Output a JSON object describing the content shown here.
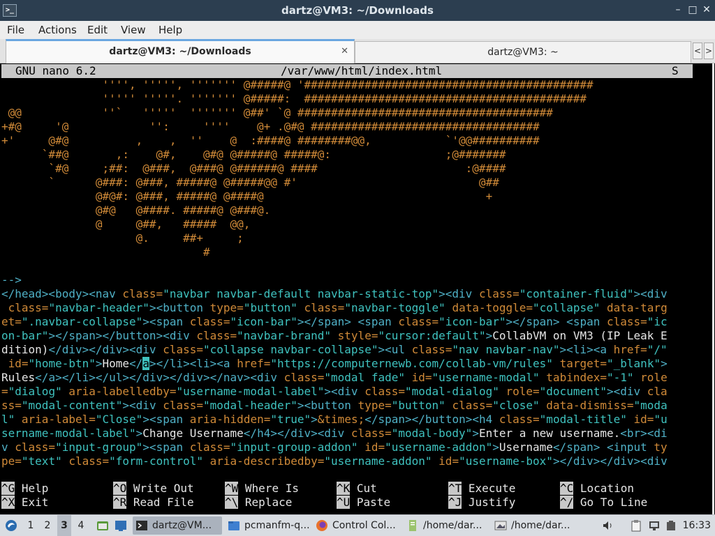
{
  "window": {
    "title": "dartz@VM3: ~/Downloads",
    "app_icon_glyph": ">_",
    "controls": {
      "minimize": "–",
      "maximize": "□",
      "close": "✕"
    }
  },
  "menubar": {
    "items": [
      "File",
      "Actions",
      "Edit",
      "View",
      "Help"
    ]
  },
  "tabs": [
    {
      "label": "dartz@VM3: ~/Downloads",
      "active": true,
      "close": "✕"
    },
    {
      "label": "dartz@VM3: ~",
      "active": false
    }
  ],
  "tab_scroll": {
    "left": "<",
    "right": ">"
  },
  "nano": {
    "version": "GNU nano 6.2",
    "file": "/var/www/html/index.html",
    "flag": "S"
  },
  "editor_lines": [
    [
      [
        "o",
        "               '''', ''''', ''''''' @#####@ '###########################################"
      ]
    ],
    [
      [
        "o",
        "               ''''' '''''. ''''''' @#####:  ##########################################"
      ]
    ],
    [
      [
        "o",
        " @@            ''`   '''''  ''''''' @##' `@ ######################################"
      ]
    ],
    [
      [
        "o",
        "+#@     '@            '':     ''''    @+ .@#@ ##################################"
      ]
    ],
    [
      [
        "o",
        "+'     @#@          ,    ,  ''    @  :####@ ########@@,           `'@@##########"
      ]
    ],
    [
      [
        "o",
        "      `##@       ,:    @#,    @#@ @#####@ #####@:                 ;@#######"
      ]
    ],
    [
      [
        "o",
        "       `#@     ;##:  @###,  @###@ @######@ ####                      :@####"
      ]
    ],
    [
      [
        "o",
        "       `      @###: @###, #####@ @#####@@ #'                           @##"
      ]
    ],
    [
      [
        "o",
        "              @#@#: @###, #####@ @####@                                 +"
      ]
    ],
    [
      [
        "o",
        "              @#@   @####. #####@ @###@."
      ]
    ],
    [
      [
        "o",
        "              @     @##,   #####  @@,"
      ]
    ],
    [
      [
        "o",
        "                    @.     ##+     ;"
      ]
    ],
    [
      [
        "o",
        "                              #"
      ]
    ],
    [
      [
        "o",
        ""
      ]
    ],
    [
      [
        "k",
        "-->"
      ]
    ],
    [
      [
        "k",
        "</head><body><nav "
      ],
      [
        "o",
        "class="
      ],
      [
        "s",
        "\"navbar navbar-default navbar-static-top\""
      ],
      [
        "k",
        "><div "
      ],
      [
        "o",
        "class="
      ],
      [
        "s",
        "\"container-fluid\""
      ],
      [
        "k",
        "><div"
      ]
    ],
    [
      [
        "k",
        " "
      ],
      [
        "o",
        "class="
      ],
      [
        "s",
        "\"navbar-header\""
      ],
      [
        "k",
        "><button "
      ],
      [
        "o",
        "type="
      ],
      [
        "s",
        "\"button\" "
      ],
      [
        "o",
        "class="
      ],
      [
        "s",
        "\"navbar-toggle\" "
      ],
      [
        "o",
        "data-toggle="
      ],
      [
        "s",
        "\"collapse\" "
      ],
      [
        "o",
        "data-targ"
      ]
    ],
    [
      [
        "o",
        "et="
      ],
      [
        "s",
        "\".navbar-collapse\""
      ],
      [
        "k",
        "><span "
      ],
      [
        "o",
        "class="
      ],
      [
        "s",
        "\"icon-bar\""
      ],
      [
        "k",
        "></span> <span "
      ],
      [
        "o",
        "class="
      ],
      [
        "s",
        "\"icon-bar\""
      ],
      [
        "k",
        "></span> <span "
      ],
      [
        "o",
        "class="
      ],
      [
        "s",
        "\"ic"
      ]
    ],
    [
      [
        "s",
        "on-bar\""
      ],
      [
        "k",
        "></span></button><div "
      ],
      [
        "o",
        "class="
      ],
      [
        "s",
        "\"navbar-brand\" "
      ],
      [
        "o",
        "style="
      ],
      [
        "s",
        "\"cursor:default\""
      ],
      [
        "k",
        ">"
      ],
      [
        "w",
        "CollabVM on VM3 (IP Leak E"
      ]
    ],
    [
      [
        "w",
        "dition)"
      ],
      [
        "k",
        "</div></div><div "
      ],
      [
        "o",
        "class="
      ],
      [
        "s",
        "\"collapse navbar-collapse\""
      ],
      [
        "k",
        "><ul "
      ],
      [
        "o",
        "class="
      ],
      [
        "s",
        "\"nav navbar-nav\""
      ],
      [
        "k",
        "><li><a "
      ],
      [
        "o",
        "href="
      ],
      [
        "s",
        "\"/\""
      ]
    ],
    [
      [
        "k",
        " "
      ],
      [
        "o",
        "id="
      ],
      [
        "s",
        "\"home-btn\""
      ],
      [
        "k",
        ">"
      ],
      [
        "w",
        "Home"
      ],
      [
        "k",
        "</"
      ],
      [
        "c",
        "a"
      ],
      [
        "k",
        "></li><li><a "
      ],
      [
        "o",
        "href="
      ],
      [
        "s",
        "\"https://computernewb.com/collab-vm/rules\" "
      ],
      [
        "o",
        "target="
      ],
      [
        "s",
        "\"_blank\""
      ],
      [
        "k",
        ">"
      ]
    ],
    [
      [
        "w",
        "Rules"
      ],
      [
        "k",
        "</a></li></ul></div></div></nav><div "
      ],
      [
        "o",
        "class="
      ],
      [
        "s",
        "\"modal fade\" "
      ],
      [
        "o",
        "id="
      ],
      [
        "s",
        "\"username-modal\" "
      ],
      [
        "o",
        "tabindex="
      ],
      [
        "s",
        "\"-1\" "
      ],
      [
        "o",
        "role"
      ]
    ],
    [
      [
        "o",
        "="
      ],
      [
        "s",
        "\"dialog\" "
      ],
      [
        "o",
        "aria-labelledby="
      ],
      [
        "s",
        "\"username-modal-label\""
      ],
      [
        "k",
        "><div "
      ],
      [
        "o",
        "class="
      ],
      [
        "s",
        "\"modal-dialog\" "
      ],
      [
        "o",
        "role="
      ],
      [
        "s",
        "\"document\""
      ],
      [
        "k",
        "><div "
      ],
      [
        "o",
        "cla"
      ]
    ],
    [
      [
        "o",
        "ss="
      ],
      [
        "s",
        "\"modal-content\""
      ],
      [
        "k",
        "><div "
      ],
      [
        "o",
        "class="
      ],
      [
        "s",
        "\"modal-header\""
      ],
      [
        "k",
        "><button "
      ],
      [
        "o",
        "type="
      ],
      [
        "s",
        "\"button\" "
      ],
      [
        "o",
        "class="
      ],
      [
        "s",
        "\"close\" "
      ],
      [
        "o",
        "data-dismiss="
      ],
      [
        "s",
        "\"moda"
      ]
    ],
    [
      [
        "s",
        "l\" "
      ],
      [
        "o",
        "aria-label="
      ],
      [
        "s",
        "\"Close\""
      ],
      [
        "k",
        "><span "
      ],
      [
        "o",
        "aria-hidden="
      ],
      [
        "s",
        "\"true\""
      ],
      [
        "k",
        ">"
      ],
      [
        "o",
        "&times;"
      ],
      [
        "k",
        "</span></button><h4 "
      ],
      [
        "o",
        "class="
      ],
      [
        "s",
        "\"modal-title\" "
      ],
      [
        "o",
        "id="
      ],
      [
        "s",
        "\"u"
      ]
    ],
    [
      [
        "s",
        "sername-modal-label\""
      ],
      [
        "k",
        ">"
      ],
      [
        "w",
        "Change Username"
      ],
      [
        "k",
        "</h4></div><div "
      ],
      [
        "o",
        "class="
      ],
      [
        "s",
        "\"modal-body\""
      ],
      [
        "k",
        ">"
      ],
      [
        "w",
        "Enter a new username."
      ],
      [
        "k",
        "<br><di"
      ]
    ],
    [
      [
        "k",
        "v "
      ],
      [
        "o",
        "class="
      ],
      [
        "s",
        "\"input-group\""
      ],
      [
        "k",
        "><span "
      ],
      [
        "o",
        "class="
      ],
      [
        "s",
        "\"input-group-addon\" "
      ],
      [
        "o",
        "id="
      ],
      [
        "s",
        "\"username-addon\""
      ],
      [
        "k",
        ">"
      ],
      [
        "w",
        "Username"
      ],
      [
        "k",
        "</span> <input "
      ],
      [
        "o",
        "ty"
      ]
    ],
    [
      [
        "o",
        "pe="
      ],
      [
        "s",
        "\"text\" "
      ],
      [
        "o",
        "class="
      ],
      [
        "s",
        "\"form-control\" "
      ],
      [
        "o",
        "aria-describedby="
      ],
      [
        "s",
        "\"username-addon\" "
      ],
      [
        "o",
        "id="
      ],
      [
        "s",
        "\"username-box\""
      ],
      [
        "k",
        "></div></div><div"
      ]
    ]
  ],
  "shortcuts": [
    {
      "key": "^G",
      "label": "Help"
    },
    {
      "key": "^O",
      "label": "Write Out"
    },
    {
      "key": "^W",
      "label": "Where Is"
    },
    {
      "key": "^K",
      "label": "Cut"
    },
    {
      "key": "^T",
      "label": "Execute"
    },
    {
      "key": "^C",
      "label": "Location"
    },
    {
      "key": "^X",
      "label": "Exit"
    },
    {
      "key": "^R",
      "label": "Read File"
    },
    {
      "key": "^\\",
      "label": "Replace"
    },
    {
      "key": "^U",
      "label": "Paste"
    },
    {
      "key": "^J",
      "label": "Justify"
    },
    {
      "key": "^/",
      "label": "Go To Line"
    }
  ],
  "taskbar": {
    "workspaces": [
      "1",
      "2",
      "3",
      "4"
    ],
    "active_workspace": "3",
    "tasks": [
      {
        "label": "dartz@VM...",
        "icon": "terminal-icon",
        "active": true
      },
      {
        "label": "pcmanfm-q...",
        "icon": "folder-icon",
        "active": false
      },
      {
        "label": "Control Col...",
        "icon": "firefox-icon",
        "active": false
      },
      {
        "label": "/home/dar...",
        "icon": "text-file-icon",
        "active": false
      },
      {
        "label": "/home/dar...",
        "icon": "image-icon",
        "active": false
      }
    ],
    "clock": "16:33"
  }
}
